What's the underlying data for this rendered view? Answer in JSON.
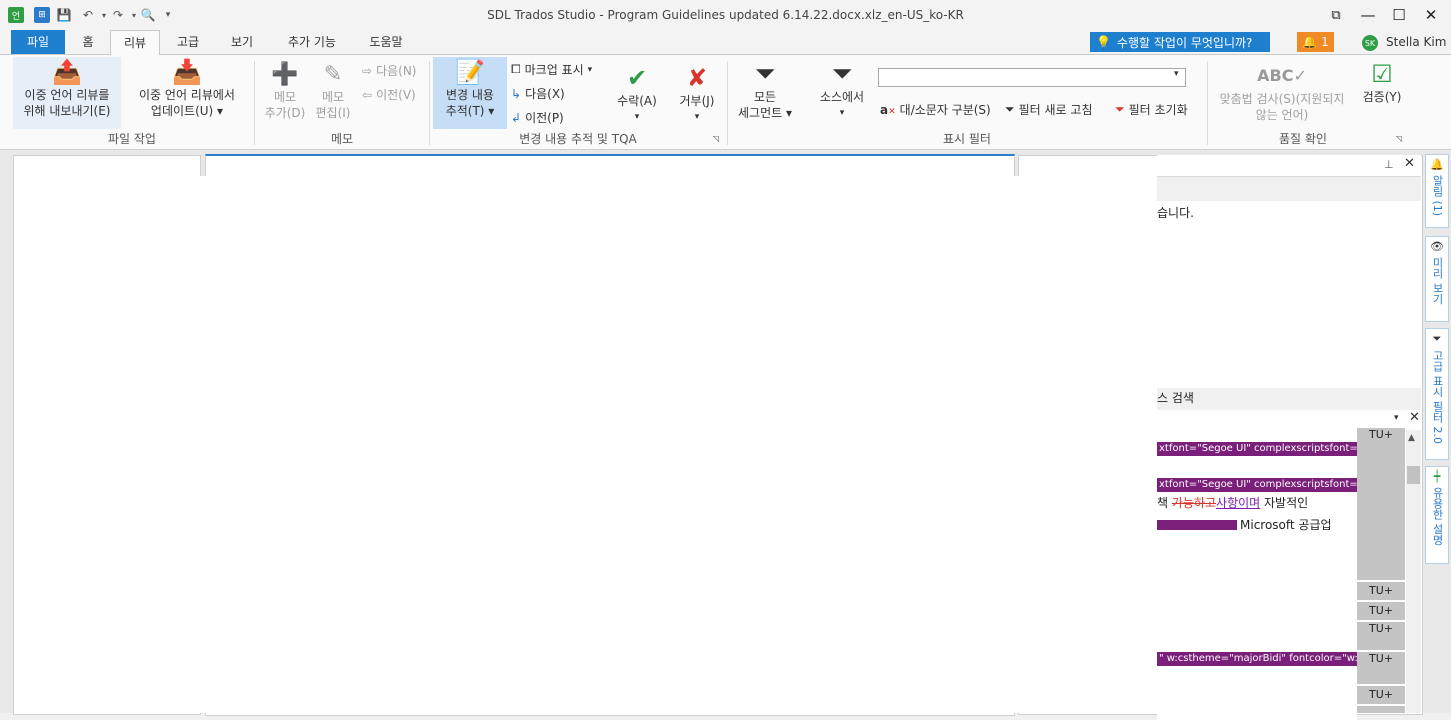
{
  "window": {
    "title": "SDL Trados Studio - Program Guidelines updated 6.14.22.docx.xlz_en-US_ko-KR",
    "minimize": "—",
    "maximize": "☐",
    "close": "✕",
    "restore": "⧉"
  },
  "tabs": [
    "파일",
    "홈",
    "리뷰",
    "고급",
    "보기",
    "추가 기능",
    "도움말"
  ],
  "tell_me": "수행할 작업이 무엇입니까?",
  "notifications_count": "1",
  "user": {
    "initials": "SK",
    "name": "Stella Kim"
  },
  "ribbon": {
    "file_ops": {
      "export_label1": "이중 언어 리뷰를",
      "export_label2": "위해 내보내기(E)",
      "update_label1": "이중 언어 리뷰에서",
      "update_label2": "업데이트(U)",
      "group": "파일 작업"
    },
    "memo": {
      "add1": "메모",
      "add2": "추가(D)",
      "edit1": "메모",
      "edit2": "편집(I)",
      "next": "다음(N)",
      "prev": "이전(V)",
      "group": "메모"
    },
    "track": {
      "track1": "변경 내용",
      "track2": "추적(T)",
      "markup": "마크업 표시",
      "next": "다음(X)",
      "prev": "이전(P)",
      "accept": "수락(A)",
      "reject": "거부(J)",
      "group": "변경 내용 추적 및 TQA"
    },
    "filter": {
      "all1": "모든",
      "all2": "세그먼트",
      "source": "소스에서",
      "case": "대/소문자 구분(S)",
      "refresh": "필터 새로 고침",
      "reset": "필터 초기화",
      "search_value": "",
      "group": "표시 필터"
    },
    "qa": {
      "spell1": "맞춤법 검사(S)(지원되지",
      "spell2": "않는 언어)",
      "verify": "검증(Y)",
      "group": "품질 확인"
    }
  },
  "panels": {
    "top_text": "습니다.",
    "search_label": "스 검색",
    "side_tabs": [
      "알림 (1)",
      "미리 보기",
      "고급 표시 필터 2.0",
      "유용한 설명"
    ]
  },
  "editor_rows": [
    {
      "tag": "xtfont=\"Segoe UI\" complexscriptsfont=\"S",
      "tu": "TU+"
    },
    {
      "tag": "xtfont=\"Segoe UI\" complexscriptsfont=\"S",
      "tu": ""
    },
    {
      "tag": "\" w:cstheme=\"majorBidi\" fontcolor=\"w:val=",
      "tu": "TU+"
    }
  ],
  "edit_text": {
    "prefix": "책 ",
    "deleted": "가능하고",
    "inserted": "사항이며",
    "suffix": " 자발적인",
    "fragment": "Microsoft 공급업"
  },
  "tu_labels": [
    "TU+",
    "TU+",
    "TU+",
    "TU+",
    "TU+",
    "TU+"
  ]
}
